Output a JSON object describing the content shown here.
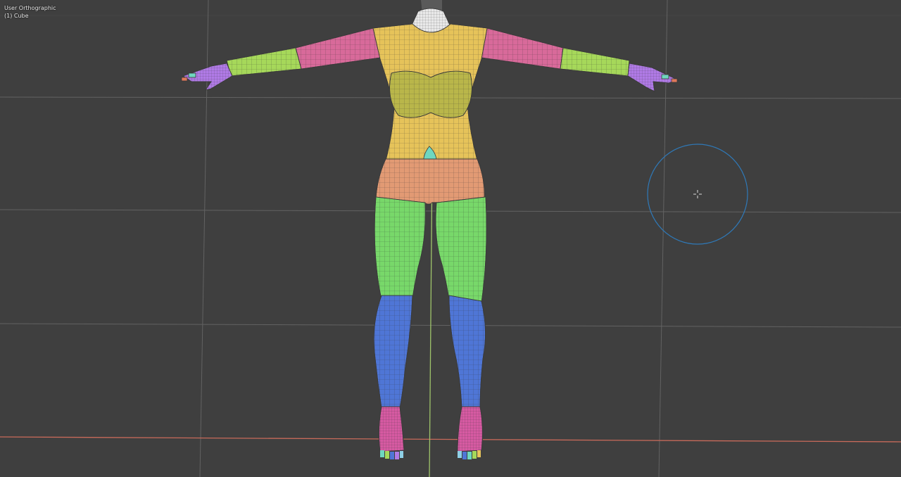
{
  "viewport": {
    "view_label": "User Orthographic",
    "object_label": "(1) Cube"
  },
  "colors": {
    "background": "#3f3f3f",
    "grid": "#7a7a7a",
    "axis_x": "#c86a5a",
    "axis_y": "#9fc46a",
    "brush": "#2f79b8",
    "neck": "#e9e9e9",
    "torso": "#e6c35a",
    "chest": "#b9b64a",
    "navel": "#6fd7c0",
    "hips": "#e29a74",
    "upper_arm": "#d86a9a",
    "forearm": "#a6d85a",
    "hand": "#b07ae6",
    "thigh": "#78d86a",
    "shin": "#4f76d6",
    "foot": "#d65aa2",
    "wire": "#3a3a3a"
  },
  "objects": [
    {
      "name": "Cube",
      "type": "mesh",
      "part_count": 12
    }
  ],
  "tool": {
    "name": "brush-cursor"
  }
}
